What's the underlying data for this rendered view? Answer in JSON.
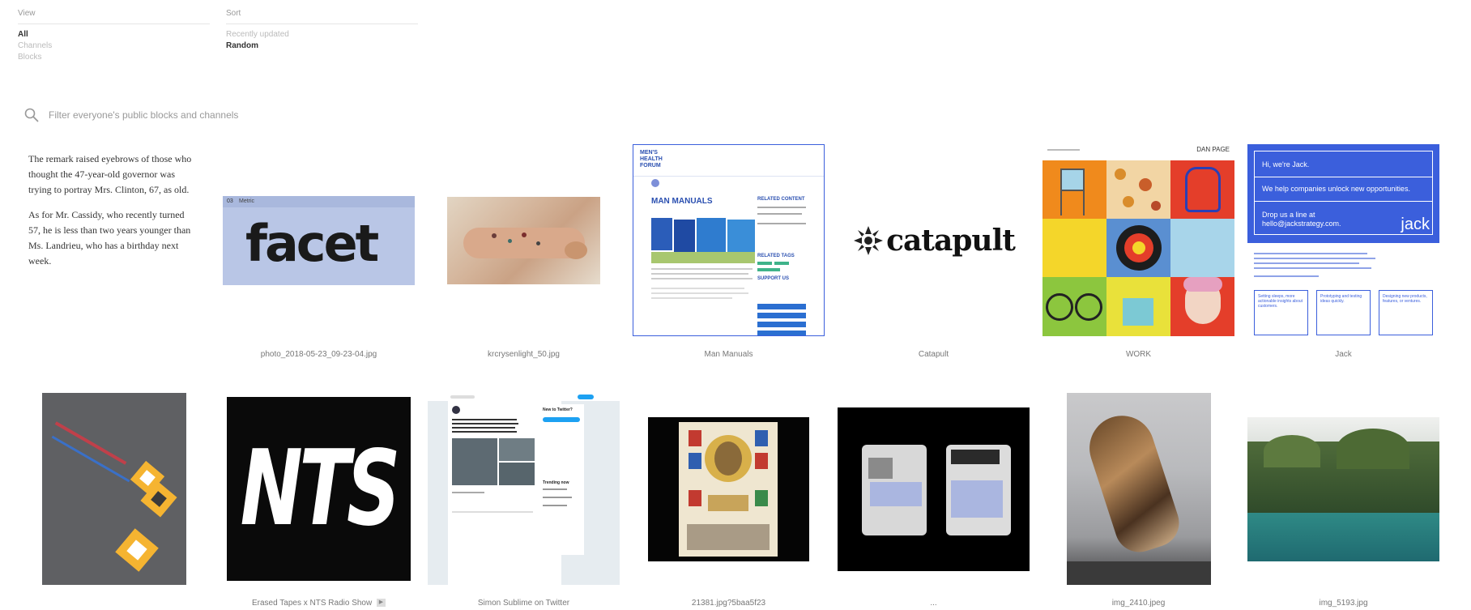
{
  "filters": {
    "view": {
      "label": "View",
      "options": [
        "All",
        "Channels",
        "Blocks"
      ],
      "active": "All"
    },
    "sort": {
      "label": "Sort",
      "options": [
        "Recently updated",
        "Random"
      ],
      "active": "Random"
    }
  },
  "search": {
    "placeholder": "Filter everyone's public blocks and channels",
    "icon": "search-icon"
  },
  "text_block": {
    "paragraph_1": "The remark raised eyebrows of those who thought the 47-year-old governor was trying to portray Mrs. Clinton, 67, as old.",
    "paragraph_2": "As for Mr. Cassidy, who recently turned 57, he is less than two years younger than Ms. Landrieu, who has a birthday next week."
  },
  "blocks": {
    "photo": {
      "caption": "photo_2018-05-23_09-23-04.jpg",
      "tag_num": "03",
      "tag_text": "Metric",
      "logo": "facet"
    },
    "krcry": {
      "caption": "krcrysenlight_50.jpg"
    },
    "man": {
      "caption": "Man Manuals",
      "brand": "MEN'S HEALTH FORUM",
      "heading": "MAN MANUALS",
      "sidebar_heading": "RELATED CONTENT",
      "tags_heading": "RELATED TAGS",
      "support_heading": "SUPPORT US"
    },
    "catapult": {
      "caption": "Catapult",
      "logo": "catapult"
    },
    "work": {
      "caption": "WORK",
      "name": "DAN PAGE"
    },
    "jack": {
      "caption": "Jack",
      "line1": "Hi, we're Jack.",
      "line2": "We help companies unlock new opportunities.",
      "line3": "Drop us a line at hello@jackstrategy.com.",
      "logo": "jack",
      "box1": "Setting sleeps, more actionable insights about customers.",
      "box2": "Prototyping and testing ideas quickly.",
      "box3": "Designing new products, features, or ventures."
    },
    "floor": {
      "caption": ""
    },
    "nts": {
      "caption": "Erased Tapes x NTS Radio Show",
      "logo": "NTS"
    },
    "twitter": {
      "caption": "Simon Sublime on Twitter",
      "sidebar_title": "New to Twitter?",
      "trending": "Trending now"
    },
    "postcard": {
      "caption": "21381.jpg?5baa5f23"
    },
    "packs": {
      "caption": "..."
    },
    "shell": {
      "caption": "img_2410.jpeg"
    },
    "lake": {
      "caption": "img_5193.jpg"
    }
  },
  "colors": {
    "accent_blue": "#3b5fdc",
    "text": "#333333",
    "muted": "#999999"
  }
}
